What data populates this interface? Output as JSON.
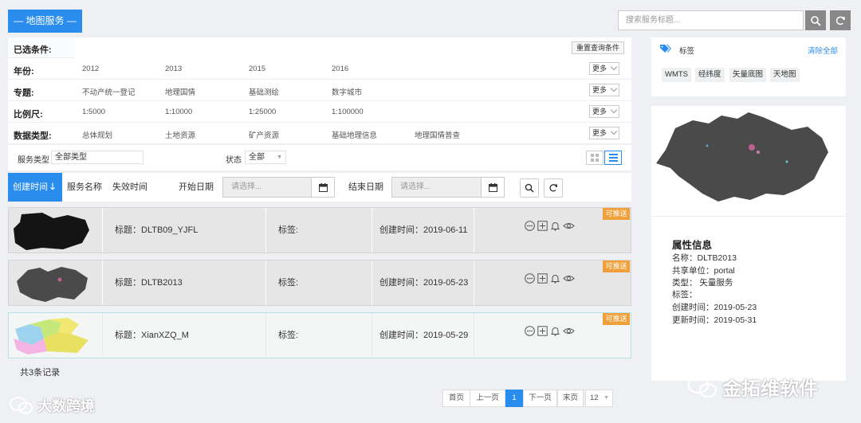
{
  "header": {
    "title": "— 地图服务 —",
    "search_placeholder": "搜索服务标题..."
  },
  "filters": {
    "selected_label": "已选条件:",
    "reset_label": "重置查询条件",
    "more_label": "更多",
    "rows": [
      {
        "label": "年份:",
        "options": [
          "2012",
          "2013",
          "2015",
          "2016"
        ]
      },
      {
        "label": "专题:",
        "options": [
          "不动产统一登记",
          "地理国情",
          "基础测绘",
          "数字城市"
        ]
      },
      {
        "label": "比例尺:",
        "options": [
          "1:5000",
          "1:10000",
          "1:25000",
          "1:100000"
        ]
      },
      {
        "label": "数据类型:",
        "options": [
          "总体规划",
          "土地资源",
          "矿产资源",
          "基础地理信息",
          "地理国情普查"
        ]
      }
    ]
  },
  "selectors": {
    "type_label": "服务类型",
    "type_value": "全部类型",
    "status_label": "状态",
    "status_value": "全部"
  },
  "sort": {
    "created": "创建时间",
    "name": "服务名称",
    "expire": "失效时间",
    "start_label": "开始日期",
    "end_label": "结束日期",
    "date_placeholder": "请选择..."
  },
  "items": [
    {
      "title": "标题：DLTB09_YJFL",
      "tags": "标签:",
      "created": "创建时间：2019-06-11",
      "badge": "可推送"
    },
    {
      "title": "标题：DLTB2013",
      "tags": "标签:",
      "created": "创建时间：2019-05-23",
      "badge": "可推送"
    },
    {
      "title": "标题：XianXZQ_M",
      "tags": "标签:",
      "created": "创建时间：2019-05-29",
      "badge": "可推送"
    }
  ],
  "total_label": "共3条记录",
  "pagination": {
    "first": "首页",
    "prev": "上一页",
    "current": "1",
    "next": "下一页",
    "last": "末页",
    "page_size": "12"
  },
  "tags_panel": {
    "title": "标签",
    "clear": "清除全部",
    "tags": [
      "WMTS",
      "经纬度",
      "矢量底图",
      "天地图"
    ]
  },
  "detail": {
    "heading": "属性信息",
    "lines": [
      "名称：DLTB2013",
      "共享单位：portal",
      "类型： 矢量服务",
      "标签：",
      "创建时间：2019-05-23",
      "更新时间：2019-05-31"
    ]
  },
  "watermarks": {
    "left": "大数跨境",
    "right": "金拓维软件"
  },
  "colors": {
    "primary": "#2a8cec",
    "badge": "#f0a03a"
  }
}
